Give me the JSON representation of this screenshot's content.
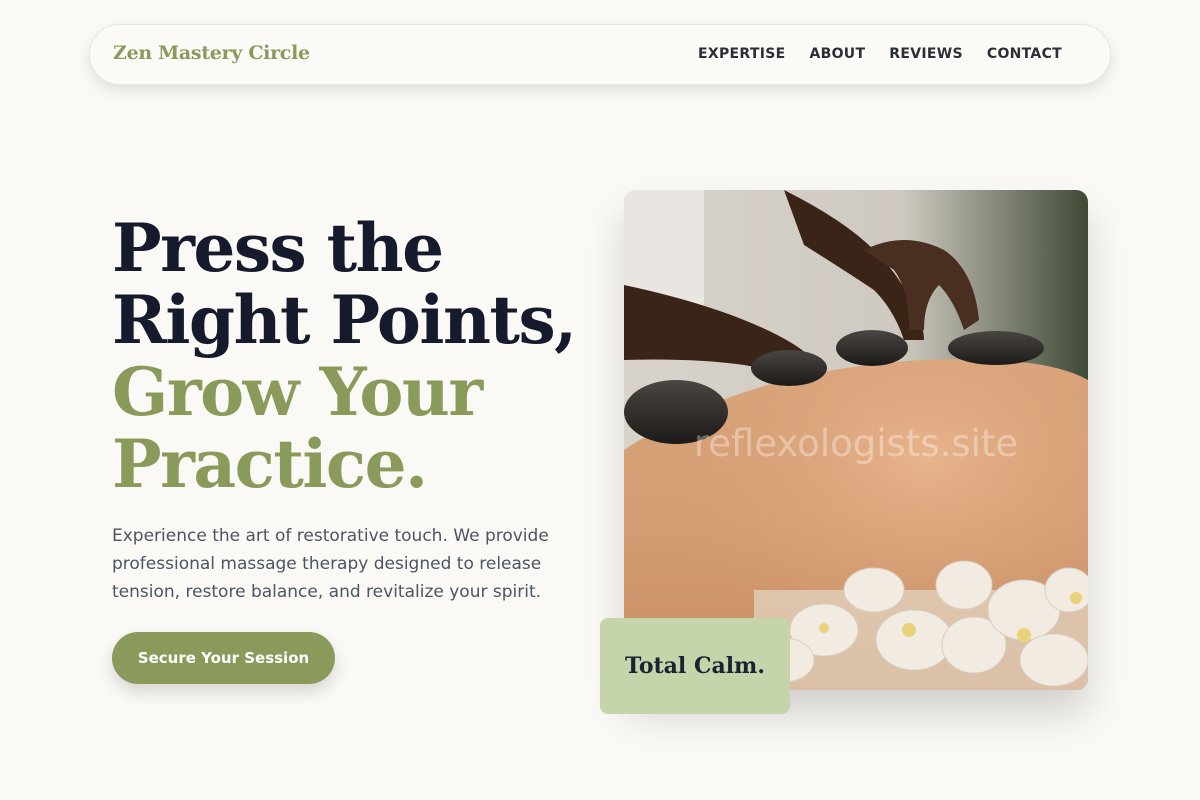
{
  "nav": {
    "brand": "Zen Mastery Circle",
    "links": [
      "EXPERTISE",
      "ABOUT",
      "REVIEWS",
      "CONTACT"
    ]
  },
  "hero": {
    "headline_dark": [
      "Press the",
      "Right Points,"
    ],
    "headline_accent": [
      "Grow Your",
      "Practice."
    ],
    "description": "Experience the art of restorative touch. We provide professional massage therapy designed to release tension, restore balance, and revitalize your spirit.",
    "cta_label": "Secure Your Session",
    "image_watermark": "reflexologists.site",
    "card_label": "Total Calm."
  },
  "colors": {
    "accent": "#8a9a5b",
    "heading": "#151a2c",
    "card": "#c5d4ab",
    "background": "#faf9f5"
  }
}
